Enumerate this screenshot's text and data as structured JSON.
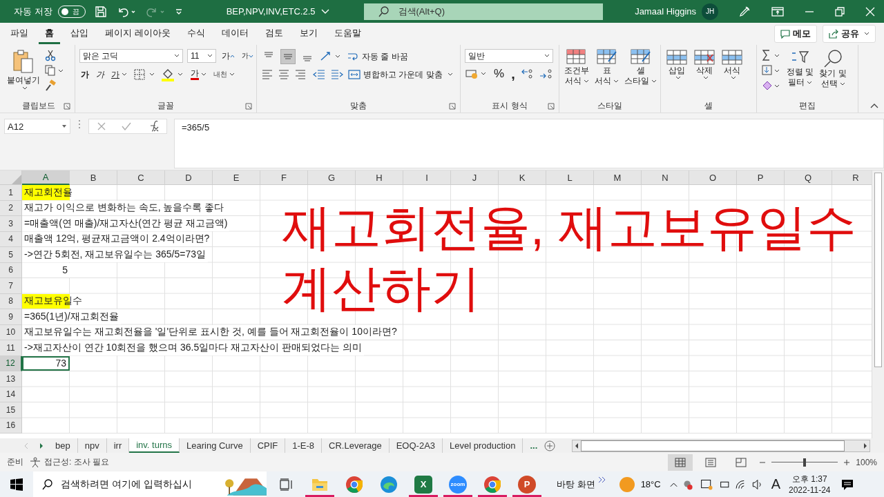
{
  "title_bar": {
    "autosave_label": "자동 저장",
    "autosave_toggle": {
      "label": "끔",
      "on": false
    },
    "file_name": "BEP,NPV,INV,ETC.2.5",
    "search_placeholder": "검색(Alt+Q)",
    "user_name": "Jamaal Higgins",
    "user_initials": "JH"
  },
  "menu_tabs": [
    {
      "label": "파일",
      "selected": false
    },
    {
      "label": "홈",
      "selected": true
    },
    {
      "label": "삽입",
      "selected": false
    },
    {
      "label": "페이지 레이아웃",
      "selected": false
    },
    {
      "label": "수식",
      "selected": false
    },
    {
      "label": "데이터",
      "selected": false
    },
    {
      "label": "검토",
      "selected": false
    },
    {
      "label": "보기",
      "selected": false
    },
    {
      "label": "도움말",
      "selected": false
    }
  ],
  "menu_buttons": {
    "comments": "메모",
    "share": "공유"
  },
  "ribbon": {
    "clipboard": {
      "label": "클립보드",
      "paste": "붙여넣기"
    },
    "font": {
      "label": "글꼴",
      "font_name": "맑은 고딕",
      "font_size": "11",
      "grow": "가",
      "shrink": "가",
      "bold": "가",
      "italic": "가",
      "underline": "가",
      "font_color": "가",
      "phonetic": "내천"
    },
    "alignment": {
      "label": "맞춤",
      "vertical_buttons": [
        {
          "selected": false
        },
        {
          "selected": true
        },
        {
          "selected": false
        }
      ],
      "wrap_text": "자동 줄 바꿈",
      "merge_center": "병합하고 가운데 맞춤"
    },
    "number": {
      "label": "표시 형식",
      "format": "일반",
      "percent": "%",
      "comma": ","
    },
    "styles": {
      "label": "스타일",
      "buttons": [
        {
          "line1": "조건부",
          "line2": "서식"
        },
        {
          "line1": "표",
          "line2": "서식"
        },
        {
          "line1": "셀",
          "line2": "스타일"
        }
      ]
    },
    "cells": {
      "label": "셀",
      "buttons": [
        "삽입",
        "삭제",
        "서식"
      ]
    },
    "editing": {
      "label": "편집",
      "buttons": [
        {
          "line1": "정렬 및",
          "line2": "필터"
        },
        {
          "line1": "찾기 및",
          "line2": "선택"
        }
      ]
    }
  },
  "formula_bar": {
    "name_box": "A12",
    "formula": "=365/5"
  },
  "sheet": {
    "columns": [
      {
        "label": "A",
        "selected": true
      },
      {
        "label": "B",
        "selected": false
      },
      {
        "label": "C",
        "selected": false
      },
      {
        "label": "D",
        "selected": false
      },
      {
        "label": "E",
        "selected": false
      },
      {
        "label": "F",
        "selected": false
      },
      {
        "label": "G",
        "selected": false
      },
      {
        "label": "H",
        "selected": false
      },
      {
        "label": "I",
        "selected": false
      },
      {
        "label": "J",
        "selected": false
      },
      {
        "label": "K",
        "selected": false
      },
      {
        "label": "L",
        "selected": false
      },
      {
        "label": "M",
        "selected": false
      },
      {
        "label": "N",
        "selected": false
      },
      {
        "label": "O",
        "selected": false
      },
      {
        "label": "P",
        "selected": false
      },
      {
        "label": "Q",
        "selected": false
      },
      {
        "label": "R",
        "selected": false
      }
    ],
    "rows": [
      {
        "header": "1",
        "selected": false,
        "cells": [
          {
            "text": "재고회전율",
            "kind": "text",
            "highlight": true,
            "selected": false
          }
        ]
      },
      {
        "header": "2",
        "selected": false,
        "cells": [
          {
            "text": "재고가 이익으로 변화하는 속도, 높을수록 좋다",
            "kind": "text",
            "highlight": false,
            "selected": false
          }
        ]
      },
      {
        "header": "3",
        "selected": false,
        "cells": [
          {
            "text": " =매출액(연 매출)/재고자산(연간 평균 재고금액)",
            "kind": "text",
            "highlight": false,
            "selected": false
          }
        ]
      },
      {
        "header": "4",
        "selected": false,
        "cells": [
          {
            "text": "매출액 12억, 평균재고금액이 2.4억이라면?",
            "kind": "text",
            "highlight": false,
            "selected": false
          }
        ]
      },
      {
        "header": "5",
        "selected": false,
        "cells": [
          {
            "text": " ->연간 5회전, 재고보유일수는 365/5=73일",
            "kind": "text",
            "highlight": false,
            "selected": false
          }
        ]
      },
      {
        "header": "6",
        "selected": false,
        "cells": [
          {
            "text": "5",
            "kind": "number",
            "highlight": false,
            "selected": false
          }
        ]
      },
      {
        "header": "7",
        "selected": false
      },
      {
        "header": "8",
        "selected": false,
        "cells": [
          {
            "text": "재고보유일수",
            "kind": "text",
            "highlight": true,
            "selected": false
          }
        ]
      },
      {
        "header": "9",
        "selected": false,
        "cells": [
          {
            "text": " =365(1년)/재고회전율",
            "kind": "text",
            "highlight": false,
            "selected": false
          }
        ]
      },
      {
        "header": "10",
        "selected": false,
        "cells": [
          {
            "text": "재고보유일수는 재고회전율을 '일'단위로 표시한 것, 예를 들어 재고회전율이 10이라면?",
            "kind": "text",
            "highlight": false,
            "selected": false
          }
        ]
      },
      {
        "header": "11",
        "selected": false,
        "cells": [
          {
            "text": " ->재고자산이 연간 10회전을 했으며 36.5일마다 재고자산이 판매되었다는 의미",
            "kind": "text",
            "highlight": false,
            "selected": false
          }
        ]
      },
      {
        "header": "12",
        "selected": true,
        "cells": [
          {
            "text": "73",
            "kind": "number",
            "highlight": false,
            "selected": true
          }
        ]
      },
      {
        "header": "13",
        "selected": false
      },
      {
        "header": "14",
        "selected": false
      },
      {
        "header": "15",
        "selected": false
      },
      {
        "header": "16",
        "selected": false
      }
    ],
    "overlay_caption": [
      "재고회전율, 재고보유일수",
      "계산하기"
    ]
  },
  "sheet_tabs": [
    {
      "label": "bep",
      "selected": false
    },
    {
      "label": "npv",
      "selected": false
    },
    {
      "label": "irr",
      "selected": false
    },
    {
      "label": "inv. turns",
      "selected": true
    },
    {
      "label": "Learing Curve",
      "selected": false
    },
    {
      "label": "CPIF",
      "selected": false
    },
    {
      "label": "1-E-8",
      "selected": false
    },
    {
      "label": "CR.Leverage",
      "selected": false
    },
    {
      "label": "EOQ-2A3",
      "selected": false
    },
    {
      "label": "Level production",
      "selected": false
    }
  ],
  "sheet_tabs_more": "...",
  "status_bar": {
    "ready": "준비",
    "accessibility": "접근성: 조사 필요",
    "views": [
      {
        "selected": true
      },
      {
        "selected": false
      },
      {
        "selected": false
      }
    ],
    "zoom_slider": {
      "level": 0.5
    },
    "zoom": "100%"
  },
  "taskbar": {
    "search_placeholder": "검색하려면 여기에 입력하십시",
    "apps": [
      {
        "kind": "explorer",
        "running": true
      },
      {
        "kind": "chrome",
        "running": false
      },
      {
        "kind": "edge",
        "running": false
      },
      {
        "kind": "excel",
        "badge": "X",
        "running": true
      },
      {
        "kind": "zoom",
        "badge": "zoom",
        "running": true
      },
      {
        "kind": "chrome",
        "running": true
      },
      {
        "kind": "powerpoint",
        "badge": "P",
        "running": true
      }
    ],
    "desktop_label": "바탕 화면",
    "weather": "18°C",
    "ime": "A",
    "time": "오후 1:37",
    "date": "2022-11-24"
  }
}
